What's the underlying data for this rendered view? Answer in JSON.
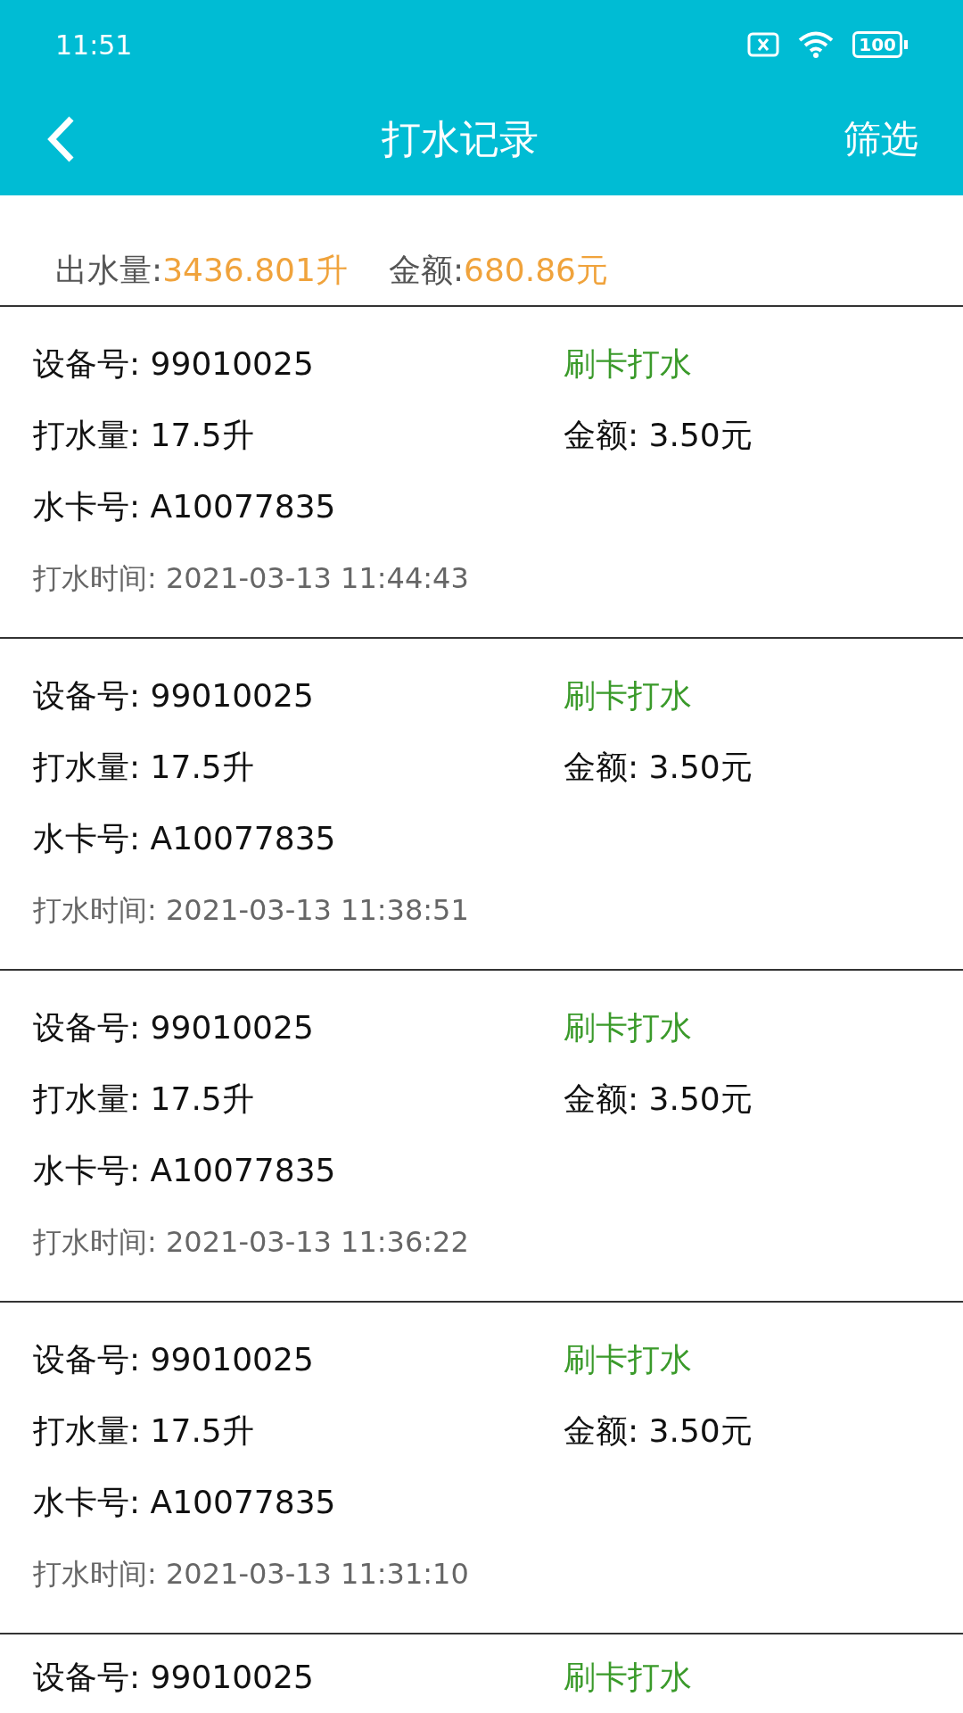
{
  "status_bar": {
    "time": "11:51",
    "battery": "100"
  },
  "header": {
    "title": "打水记录",
    "filter": "筛选"
  },
  "summary": {
    "volume_label": "出水量:",
    "volume": "3436.801升",
    "amount_label": "金额:",
    "amount": "680.86元"
  },
  "records": [
    {
      "device": "设备号: 99010025",
      "type": "刷卡打水",
      "volume": "打水量: 17.5升",
      "amount": "金额: 3.50元",
      "card": "水卡号: A10077835",
      "time": "打水时间: 2021-03-13 11:44:43"
    },
    {
      "device": "设备号: 99010025",
      "type": "刷卡打水",
      "volume": "打水量: 17.5升",
      "amount": "金额: 3.50元",
      "card": "水卡号: A10077835",
      "time": "打水时间: 2021-03-13 11:38:51"
    },
    {
      "device": "设备号: 99010025",
      "type": "刷卡打水",
      "volume": "打水量: 17.5升",
      "amount": "金额: 3.50元",
      "card": "水卡号: A10077835",
      "time": "打水时间: 2021-03-13 11:36:22"
    },
    {
      "device": "设备号: 99010025",
      "type": "刷卡打水",
      "volume": "打水量: 17.5升",
      "amount": "金额: 3.50元",
      "card": "水卡号: A10077835",
      "time": "打水时间: 2021-03-13 11:31:10"
    },
    {
      "device": "设备号: 99010025",
      "type": "刷卡打水"
    }
  ]
}
